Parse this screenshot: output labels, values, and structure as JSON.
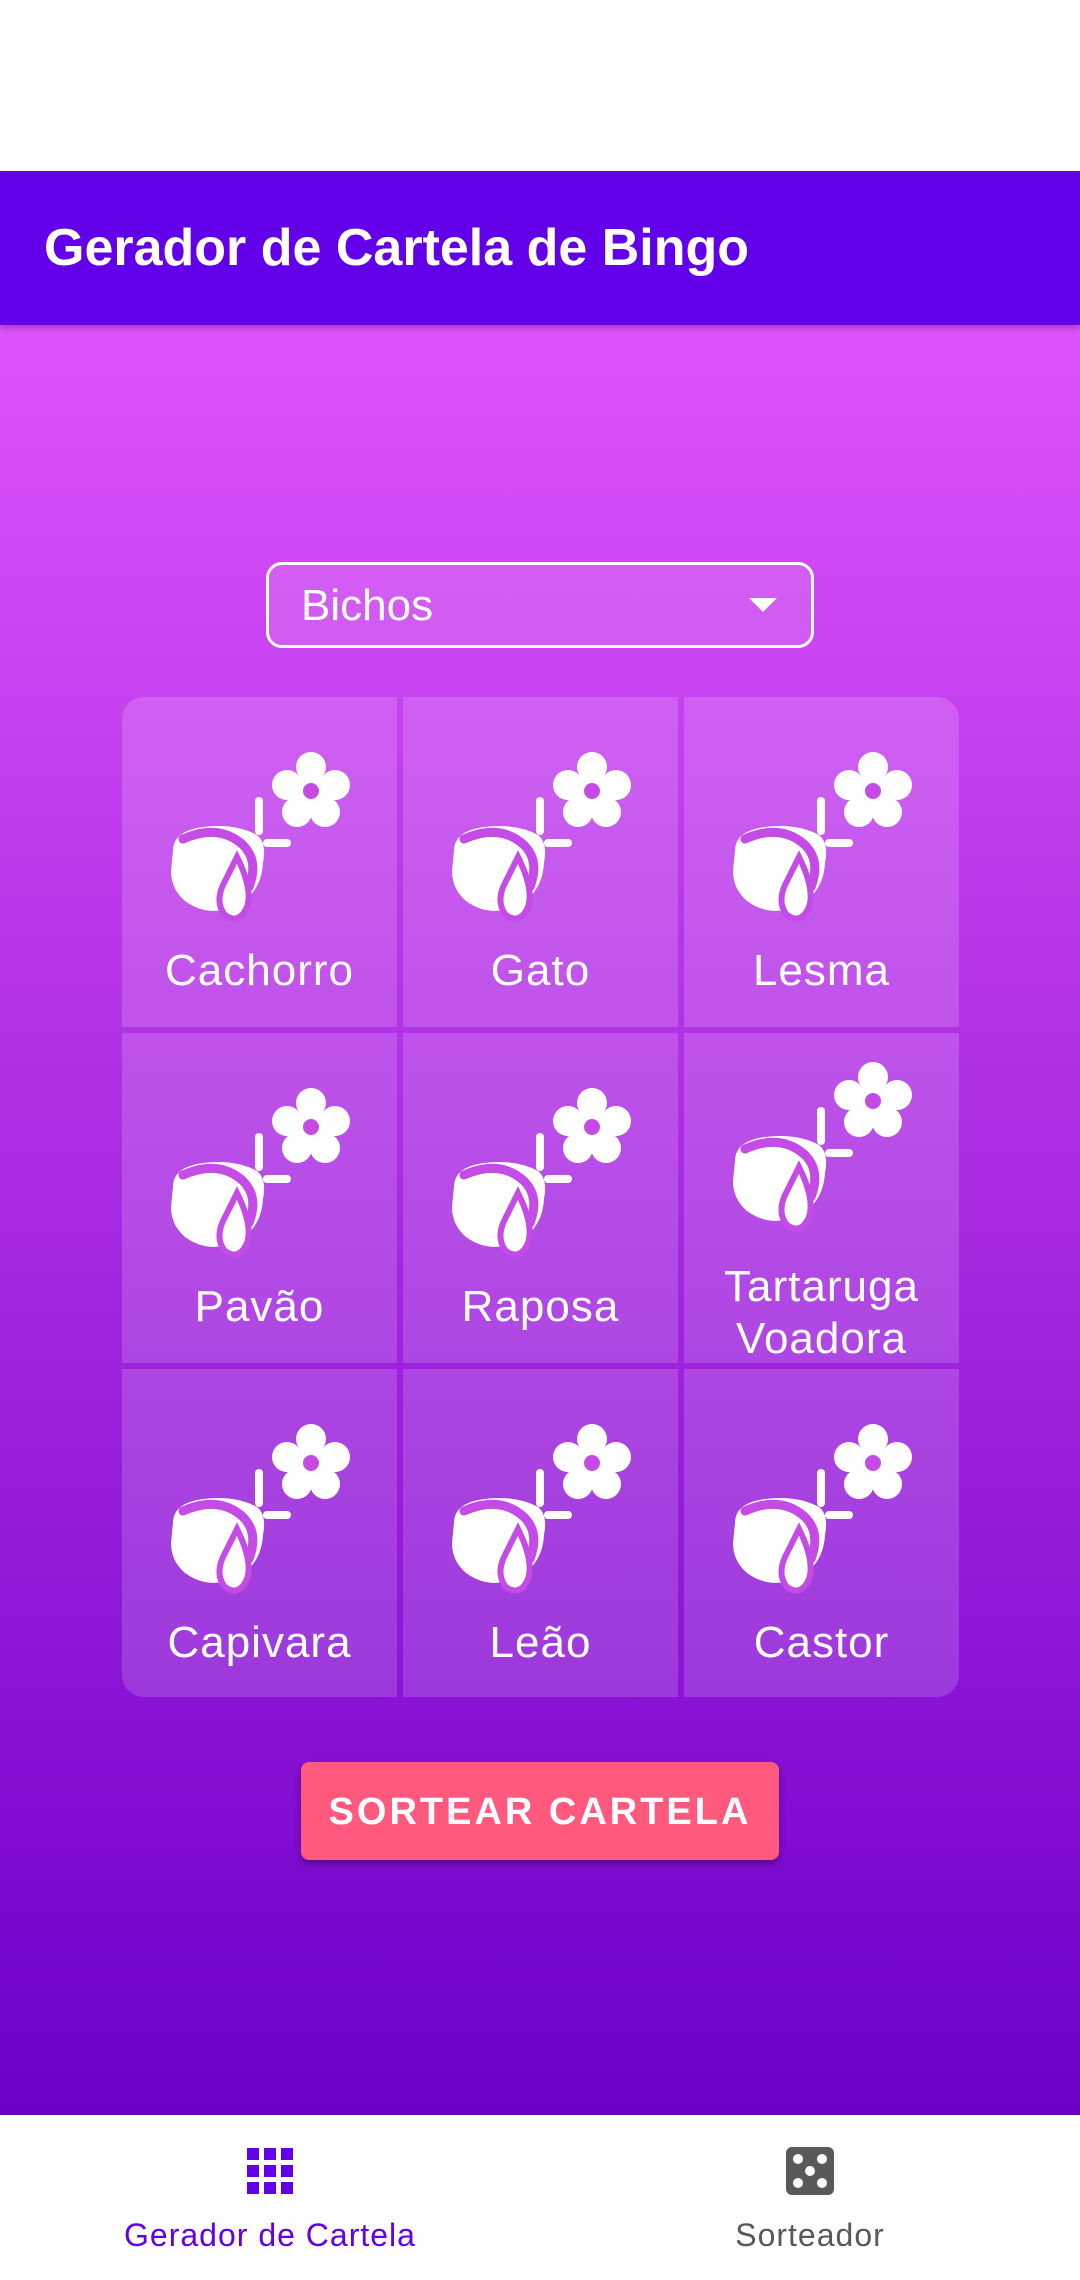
{
  "app_bar": {
    "title": "Gerador de Cartela de Bingo",
    "color": "#6200ea"
  },
  "dropdown": {
    "selected": "Bichos",
    "icon": "dropdown-arrow-icon"
  },
  "grid": {
    "icon": "flower-teapot-icon",
    "cells": [
      {
        "label": "Cachorro"
      },
      {
        "label": "Gato"
      },
      {
        "label": "Lesma"
      },
      {
        "label": "Pavão"
      },
      {
        "label": "Raposa"
      },
      {
        "label": "Tartaruga Voadora"
      },
      {
        "label": "Capivara"
      },
      {
        "label": "Leão"
      },
      {
        "label": "Castor"
      }
    ]
  },
  "cta": {
    "label": "SORTEAR CARTELA",
    "color": "#ff5a7e"
  },
  "bottom_nav": {
    "items": [
      {
        "label": "Gerador de Cartela",
        "icon": "grid-icon",
        "active": true,
        "color": "#6200ea"
      },
      {
        "label": "Sorteador",
        "icon": "dice-icon",
        "active": false,
        "color": "#595959"
      }
    ]
  },
  "colors": {
    "gradient_top": "#dd52fa",
    "gradient_bottom": "#6c00c8"
  }
}
